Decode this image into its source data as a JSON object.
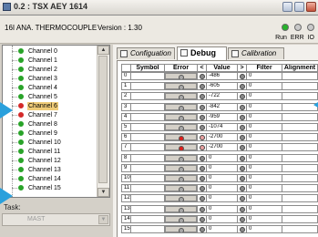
{
  "window": {
    "title": "0.2 : TSX AEY 1614",
    "module": "16I ANA. THERMOCOUPLE",
    "version": "Version : 1.30",
    "leds": [
      {
        "name": "Run",
        "color": "#27b22b"
      },
      {
        "name": "ERR",
        "color": "#c9c9c9"
      },
      {
        "name": "IO",
        "color": "#c9c9c9"
      }
    ],
    "led_labels": [
      "Run",
      "ERR",
      "IO"
    ]
  },
  "channels": [
    {
      "label": "Channel 0",
      "color": "#29a329"
    },
    {
      "label": "Channel 1",
      "color": "#29a329"
    },
    {
      "label": "Channel 2",
      "color": "#29a329"
    },
    {
      "label": "Channel 3",
      "color": "#29a329"
    },
    {
      "label": "Channel 4",
      "color": "#29a329"
    },
    {
      "label": "Channel 5",
      "color": "#29a329"
    },
    {
      "label": "Channel 6",
      "color": "#d42a2a",
      "selected": true
    },
    {
      "label": "Channel 7",
      "color": "#d42a2a"
    },
    {
      "label": "Channel 8",
      "color": "#29a329"
    },
    {
      "label": "Channel 9",
      "color": "#29a329"
    },
    {
      "label": "Channel 10",
      "color": "#29a329"
    },
    {
      "label": "Channel 11",
      "color": "#29a329"
    },
    {
      "label": "Channel 12",
      "color": "#29a329"
    },
    {
      "label": "Channel 13",
      "color": "#29a329"
    },
    {
      "label": "Channel 14",
      "color": "#29a329"
    },
    {
      "label": "Channel 15",
      "color": "#29a329"
    }
  ],
  "task": {
    "label": "Task:",
    "value": "MAST"
  },
  "tabs": [
    {
      "label": "Configuation",
      "active": false
    },
    {
      "label": "Debug",
      "active": true
    },
    {
      "label": "Calibration",
      "active": false
    }
  ],
  "table": {
    "headers": [
      "",
      "Symbol",
      "Error",
      "<",
      "Value",
      ">",
      "Filter",
      "Alignment"
    ],
    "rows": [
      {
        "n": "0",
        "error": "#a9a9a9",
        "lt": "#8a8a8a",
        "value": "-486",
        "gt": "#8a8a8a",
        "filter": "0"
      },
      {
        "n": "1",
        "error": "#a9a9a9",
        "lt": "#8a8a8a",
        "value": "-605",
        "gt": "#8a8a8a",
        "filter": "0"
      },
      {
        "n": "2",
        "error": "#a9a9a9",
        "lt": "#8a8a8a",
        "value": "-722",
        "gt": "#8a8a8a",
        "filter": "0"
      },
      {
        "n": "3",
        "error": "#a9a9a9",
        "lt": "#8a8a8a",
        "value": "-842",
        "gt": "#8a8a8a",
        "filter": "0"
      },
      {
        "n": "4",
        "error": "#a9a9a9",
        "lt": "#8a8a8a",
        "value": "-959",
        "gt": "#8a8a8a",
        "filter": "0"
      },
      {
        "n": "5",
        "error": "#a9a9a9",
        "lt": "#8a8a8a",
        "value": "-1074",
        "gt": "#8a8a8a",
        "filter": "0"
      },
      {
        "n": "6",
        "error": "#e0201c",
        "lt": "#e8a0a0",
        "value": "-2700",
        "gt": "#8a8a8a",
        "filter": "0"
      },
      {
        "n": "7",
        "error": "#e0201c",
        "lt": "#e8a0a0",
        "value": "-2700",
        "gt": "#8a8a8a",
        "filter": "0"
      },
      {
        "n": "8",
        "error": "#a9a9a9",
        "lt": "#8a8a8a",
        "value": "0",
        "gt": "#8a8a8a",
        "filter": "0"
      },
      {
        "n": "9",
        "error": "#a9a9a9",
        "lt": "#8a8a8a",
        "value": "0",
        "gt": "#8a8a8a",
        "filter": "0"
      },
      {
        "n": "10",
        "error": "#a9a9a9",
        "lt": "#8a8a8a",
        "value": "0",
        "gt": "#8a8a8a",
        "filter": "0"
      },
      {
        "n": "11",
        "error": "#a9a9a9",
        "lt": "#8a8a8a",
        "value": "0",
        "gt": "#8a8a8a",
        "filter": "0"
      },
      {
        "n": "12",
        "error": "#a9a9a9",
        "lt": "#8a8a8a",
        "value": "0",
        "gt": "#8a8a8a",
        "filter": "0"
      },
      {
        "n": "13",
        "error": "#a9a9a9",
        "lt": "#8a8a8a",
        "value": "0",
        "gt": "#8a8a8a",
        "filter": "0"
      },
      {
        "n": "14",
        "error": "#a9a9a9",
        "lt": "#8a8a8a",
        "value": "0",
        "gt": "#8a8a8a",
        "filter": "0"
      },
      {
        "n": "15",
        "error": "#a9a9a9",
        "lt": "#8a8a8a",
        "value": "0",
        "gt": "#8a8a8a",
        "filter": "0"
      }
    ]
  },
  "colors": {
    "accent_arrow": "#2aa0dc"
  }
}
